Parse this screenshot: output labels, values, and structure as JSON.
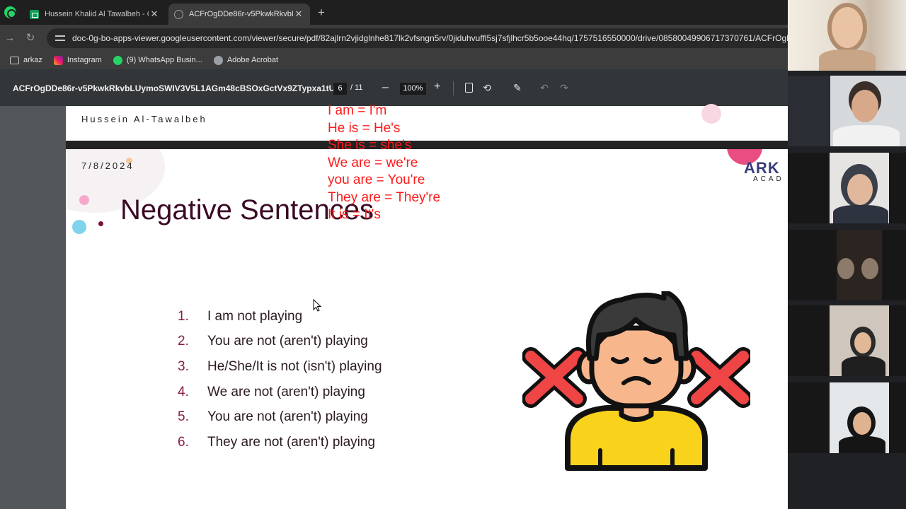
{
  "browser": {
    "tabs": [
      {
        "title": "Hussein Khalid Al Tawalbeh - G",
        "icon": "sheets-icon",
        "active": false
      },
      {
        "title": "ACFrOgDDe86r-v5PkwkRkvbLU",
        "icon": "globe-icon",
        "active": true
      }
    ],
    "url": "doc-0g-bo-apps-viewer.googleusercontent.com/viewer/secure/pdf/82ajlrn2vjidglnhe817lk2vfsngn5rv/0jiduhvuffl5sj7sfjlhcr5b5ooe44hq/1757516550000/drive/08580049906717370761/ACFrOgDD",
    "bookmarks": [
      {
        "label": "arkaz",
        "icon": "folder-icon"
      },
      {
        "label": "Instagram",
        "icon": "instagram-icon"
      },
      {
        "label": "(9) WhatsApp Busin...",
        "icon": "whatsapp-icon"
      },
      {
        "label": "Adobe Acrobat",
        "icon": "acrobat-icon"
      }
    ]
  },
  "pdf_toolbar": {
    "doc_name": "ACFrOgDDe86r-v5PkwkRkvbLUymoSWIV3V5L1AGm48cBSOxGctVx9ZTypxa1tUY...",
    "current_page": "6",
    "total_pages": "/ 11",
    "zoom": "100%",
    "zoom_minus": "–",
    "zoom_plus": "+"
  },
  "previous_page": {
    "author": "Hussein Al-Tawalbeh"
  },
  "slide": {
    "date": "7/8/2024",
    "title": "Negative Sentences",
    "logo_text": "ARK",
    "logo_sub": "ACAD",
    "list": [
      {
        "num": "1.",
        "text": "I am not playing"
      },
      {
        "num": "2.",
        "text": "You are not (aren't) playing"
      },
      {
        "num": "3.",
        "text": "He/She/It is not (isn't) playing"
      },
      {
        "num": "4.",
        "text": "We are not (aren't) playing"
      },
      {
        "num": "5.",
        "text": "You are not (aren't) playing"
      },
      {
        "num": "6.",
        "text": "They are not (aren't) playing"
      }
    ],
    "annotations": [
      "I am = I'm",
      "He is = He's",
      "She is = she's",
      "We are = we're",
      "you are = You're",
      "They are = They're",
      "It is = It's"
    ]
  },
  "colors": {
    "annotation": "#ff1a1a",
    "title": "#3b0a26",
    "list_number": "#8a1c4a"
  }
}
